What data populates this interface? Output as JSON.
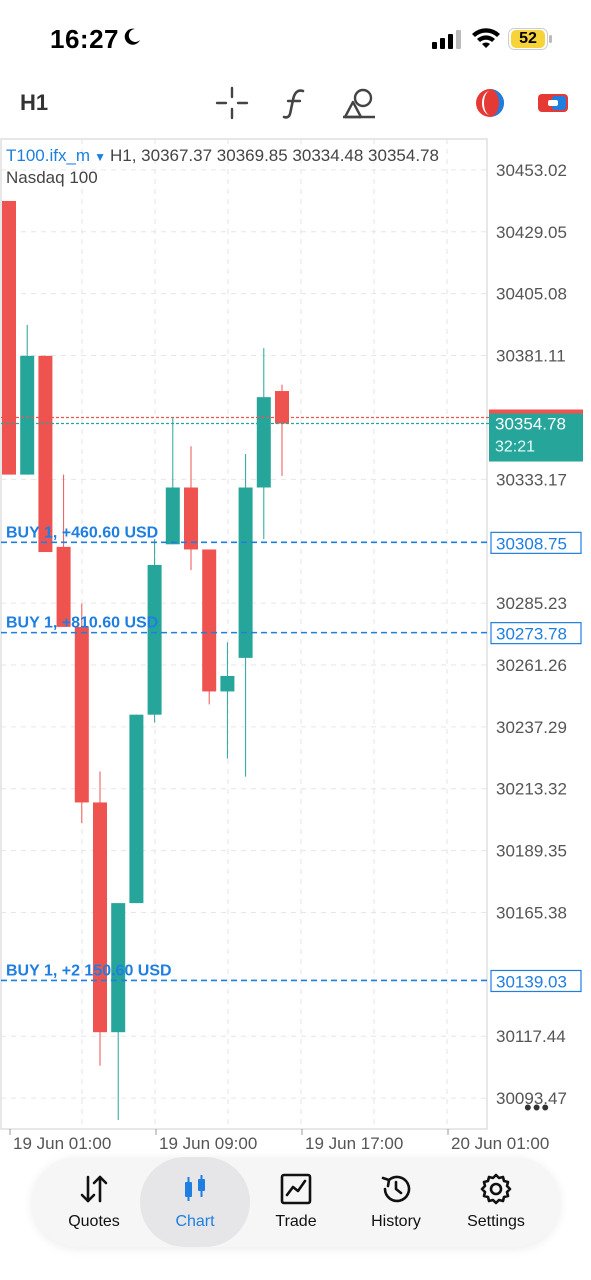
{
  "status_bar": {
    "time": "16:27",
    "battery": "52"
  },
  "toolbar": {
    "timeframe": "H1",
    "icons": [
      "crosshair-icon",
      "indicator-f-icon",
      "objects-icon",
      "color-theme-icon",
      "trade-toggle-icon"
    ]
  },
  "chart": {
    "symbol": "T100.ifx_m",
    "ohlc": "H1, 30367.37 30369.85 30334.48 30354.78",
    "description": "Nasdaq 100",
    "price_ticks": [
      "30453.02",
      "30429.05",
      "30405.08",
      "30381.11",
      "30333.17",
      "30285.23",
      "30261.26",
      "30237.29",
      "30213.32",
      "30189.35",
      "30165.38",
      "30117.44",
      "30093.47"
    ],
    "current_price": "30354.78",
    "countdown": "32:21",
    "time_ticks": [
      "19 Jun 01:00",
      "19 Jun 09:00",
      "19 Jun 17:00",
      "20 Jun 01:00"
    ],
    "positions": [
      {
        "label": "BUY 1, +460.60 USD",
        "price": "30308.75"
      },
      {
        "label": "BUY 1, +810.60 USD",
        "price": "30273.78"
      },
      {
        "label": "BUY 1, +2 150.60 USD",
        "price": "30139.03"
      }
    ],
    "colors": {
      "bull": "#26a69a",
      "bear": "#ef5350",
      "position": "#1e7fe0",
      "grid": "#e6e6e6"
    }
  },
  "chart_data": {
    "type": "candlestick",
    "ylim": [
      30081.5,
      30465.0
    ],
    "candles": [
      {
        "o": 30441.0,
        "h": 30441.0,
        "l": 30335.0,
        "c": 30335.0
      },
      {
        "o": 30335.0,
        "h": 30393.0,
        "l": 30335.0,
        "c": 30381.0
      },
      {
        "o": 30381.0,
        "h": 30381.0,
        "l": 30305.0,
        "c": 30305.0
      },
      {
        "o": 30307.0,
        "h": 30335.0,
        "l": 30276.0,
        "c": 30276.0
      },
      {
        "o": 30276.0,
        "h": 30285.0,
        "l": 30200.0,
        "c": 30208.0
      },
      {
        "o": 30208.0,
        "h": 30220.0,
        "l": 30106.0,
        "c": 30119.0
      },
      {
        "o": 30119.0,
        "h": 30169.0,
        "l": 30085.0,
        "c": 30169.0
      },
      {
        "o": 30169.0,
        "h": 30242.0,
        "l": 30169.0,
        "c": 30242.0
      },
      {
        "o": 30242.0,
        "h": 30310.0,
        "l": 30239.0,
        "c": 30300.0
      },
      {
        "o": 30308.0,
        "h": 30357.0,
        "l": 30308.0,
        "c": 30330.0
      },
      {
        "o": 30330.0,
        "h": 30346.0,
        "l": 30298.0,
        "c": 30306.0
      },
      {
        "o": 30306.0,
        "h": 30306.0,
        "l": 30246.0,
        "c": 30251.0
      },
      {
        "o": 30251.0,
        "h": 30270.0,
        "l": 30225.0,
        "c": 30257.0
      },
      {
        "o": 30264.0,
        "h": 30343.0,
        "l": 30218.0,
        "c": 30330.0
      },
      {
        "o": 30330.0,
        "h": 30384.0,
        "l": 30310.0,
        "c": 30365.0
      },
      {
        "o": 30367.37,
        "h": 30369.85,
        "l": 30334.48,
        "c": 30354.78
      }
    ]
  },
  "nav": [
    {
      "label": "Quotes",
      "icon": "quotes-icon"
    },
    {
      "label": "Chart",
      "icon": "chart-icon"
    },
    {
      "label": "Trade",
      "icon": "trade-icon"
    },
    {
      "label": "History",
      "icon": "history-icon"
    },
    {
      "label": "Settings",
      "icon": "settings-icon"
    }
  ]
}
